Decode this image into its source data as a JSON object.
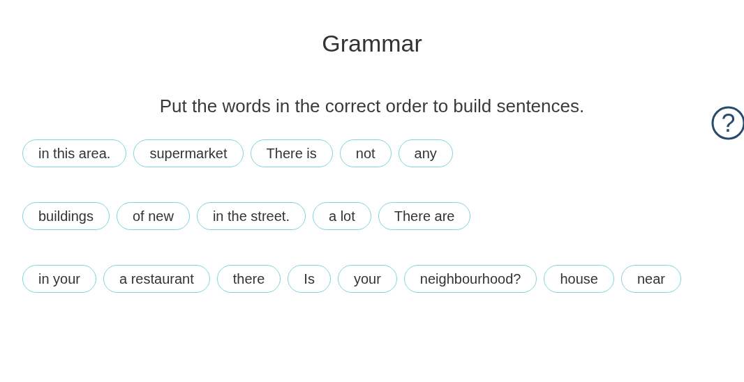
{
  "title": "Grammar",
  "instruction": "Put the words in the correct order to build sentences.",
  "help": {
    "label": "?"
  },
  "rows": [
    {
      "chips": [
        "in this area.",
        "supermarket",
        "There is",
        "not",
        "any"
      ]
    },
    {
      "chips": [
        "buildings",
        "of new",
        "in the street.",
        "a lot",
        "There are"
      ]
    },
    {
      "chips": [
        "in your",
        "a restaurant",
        "there",
        "Is",
        "your",
        "neighbourhood?",
        "house",
        "near"
      ]
    }
  ]
}
